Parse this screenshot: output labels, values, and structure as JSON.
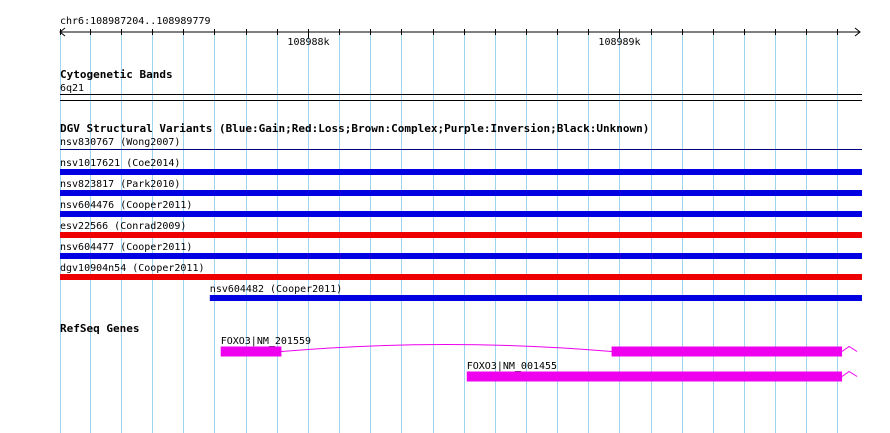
{
  "ruler": {
    "location": "chr6:108987204..108989779",
    "ticks": [
      {
        "pos": 108987204,
        "major": false
      },
      {
        "pos": 108987300,
        "major": false
      },
      {
        "pos": 108987400,
        "major": false
      },
      {
        "pos": 108987500,
        "major": false
      },
      {
        "pos": 108987600,
        "major": false
      },
      {
        "pos": 108987700,
        "major": false
      },
      {
        "pos": 108987800,
        "major": false
      },
      {
        "pos": 108987900,
        "major": false
      },
      {
        "pos": 108988000,
        "major": true,
        "label": "108988k"
      },
      {
        "pos": 108988100,
        "major": false
      },
      {
        "pos": 108988200,
        "major": false
      },
      {
        "pos": 108988300,
        "major": false
      },
      {
        "pos": 108988400,
        "major": false
      },
      {
        "pos": 108988500,
        "major": false
      },
      {
        "pos": 108988600,
        "major": false
      },
      {
        "pos": 108988700,
        "major": false
      },
      {
        "pos": 108988800,
        "major": false
      },
      {
        "pos": 108988900,
        "major": false
      },
      {
        "pos": 108989000,
        "major": true,
        "label": "108989k"
      },
      {
        "pos": 108989100,
        "major": false
      },
      {
        "pos": 108989200,
        "major": false
      },
      {
        "pos": 108989300,
        "major": false
      },
      {
        "pos": 108989400,
        "major": false
      },
      {
        "pos": 108989500,
        "major": false
      },
      {
        "pos": 108989600,
        "major": false
      },
      {
        "pos": 108989700,
        "major": false
      }
    ]
  },
  "tracks": {
    "cytogenetic": {
      "title": "Cytogenetic Bands",
      "band_label": "6q21"
    },
    "dgv": {
      "title": "DGV Structural Variants (Blue:Gain;Red:Loss;Brown:Complex;Purple:Inversion;Black:Unknown)",
      "colors": {
        "gain": "#0000e0",
        "loss": "#ee0000",
        "unknown": "#000080"
      },
      "variants": [
        {
          "label": "nsv830767 (Wong2007)",
          "start": 108987204,
          "end": 108989779,
          "type": "unknown"
        },
        {
          "label": "nsv1017621 (Coe2014)",
          "start": 108987204,
          "end": 108989779,
          "type": "gain"
        },
        {
          "label": "nsv823817 (Park2010)",
          "start": 108987204,
          "end": 108989779,
          "type": "gain"
        },
        {
          "label": "nsv604476 (Cooper2011)",
          "start": 108987204,
          "end": 108989779,
          "type": "gain"
        },
        {
          "label": "esv22566 (Conrad2009)",
          "start": 108987204,
          "end": 108989779,
          "type": "loss"
        },
        {
          "label": "nsv604477 (Cooper2011)",
          "start": 108987204,
          "end": 108989779,
          "type": "gain"
        },
        {
          "label": "dgv10904n54 (Cooper2011)",
          "start": 108987204,
          "end": 108989779,
          "type": "loss"
        },
        {
          "label": "nsv604482 (Cooper2011)",
          "start": 108987685,
          "end": 108989779,
          "type": "gain"
        }
      ]
    },
    "refseq": {
      "title": "RefSeq Genes",
      "color": "#ee00ee",
      "genes": [
        {
          "label": "FOXO3|NM_201559",
          "start": 108987720,
          "end": 108989779,
          "exons": [
            [
              108987720,
              108987915
            ],
            [
              108988975,
              108989715
            ]
          ]
        },
        {
          "label": "FOXO3|NM_001455",
          "start": 108988510,
          "end": 108989779,
          "exons": [
            [
              108988510,
              108989715
            ]
          ]
        }
      ]
    }
  }
}
